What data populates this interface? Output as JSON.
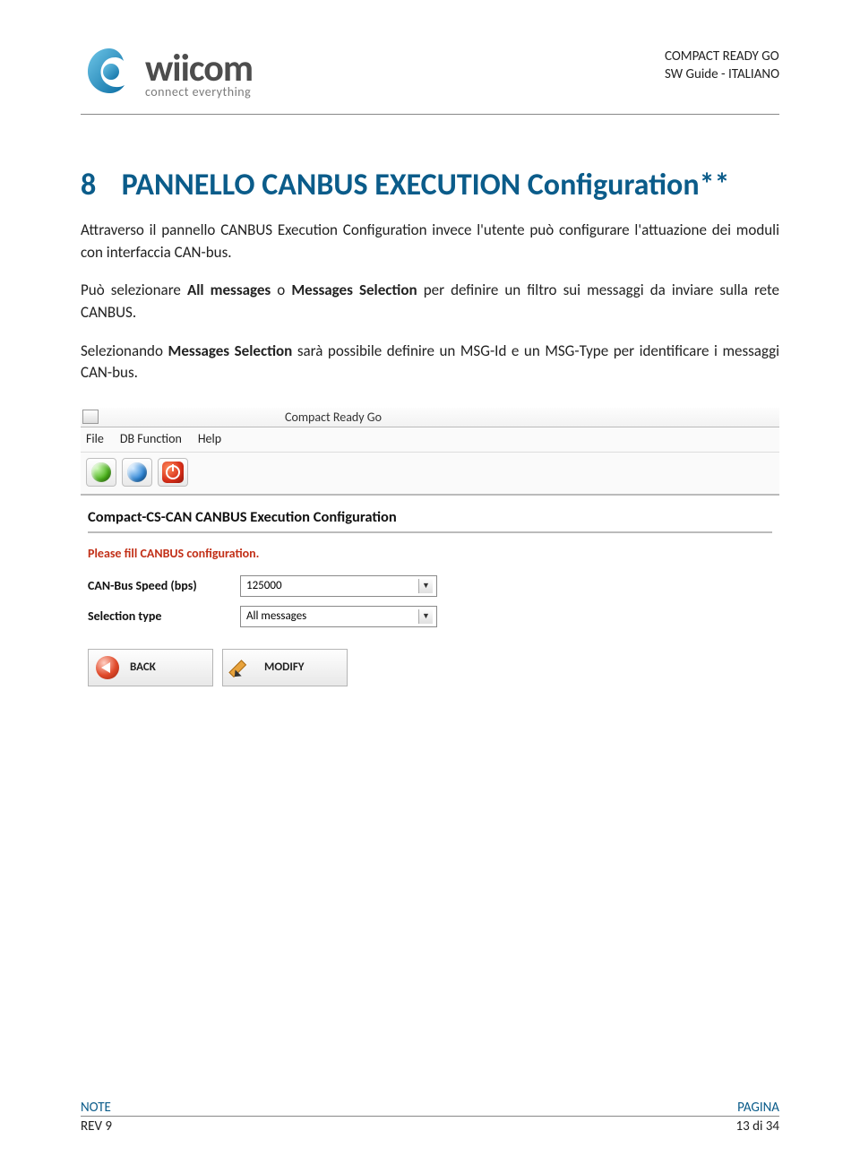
{
  "header": {
    "logo_main": "wiicom",
    "logo_sub": "connect everything",
    "right_line1": "COMPACT READY GO",
    "right_line2": "SW Guide - ITALIANO"
  },
  "section": {
    "number": "8",
    "title": "PANNELLO CANBUS EXECUTION Configuration**"
  },
  "paragraphs": {
    "p1": "Attraverso il pannello CANBUS Execution Configuration invece l'utente può configurare l'attuazione dei moduli con interfaccia CAN-bus.",
    "p2_pre": "Può selezionare ",
    "p2_b1": "All messages",
    "p2_mid": " o ",
    "p2_b2": "Messages Selection",
    "p2_post": " per definire un filtro sui messaggi da inviare sulla rete CANBUS.",
    "p3_pre": "Selezionando ",
    "p3_b1": "Messages Selection",
    "p3_post": " sarà possibile definire un MSG-Id e un MSG-Type per identificare i messaggi CAN-bus."
  },
  "app": {
    "window_title": "Compact Ready Go",
    "menu": {
      "file": "File",
      "db": "DB Function",
      "help": "Help"
    },
    "panel_title": "Compact-CS-CAN CANBUS Execution Configuration",
    "warning": "Please fill CANBUS configuration.",
    "rows": [
      {
        "label": "CAN-Bus Speed (bps)",
        "value": "125000"
      },
      {
        "label": "Selection type",
        "value": "All messages"
      }
    ],
    "buttons": {
      "back": "BACK",
      "modify": "MODIFY"
    }
  },
  "footer": {
    "note": "NOTE",
    "rev": "REV 9",
    "pagina": "PAGINA",
    "pagenum": "13 di 34"
  }
}
